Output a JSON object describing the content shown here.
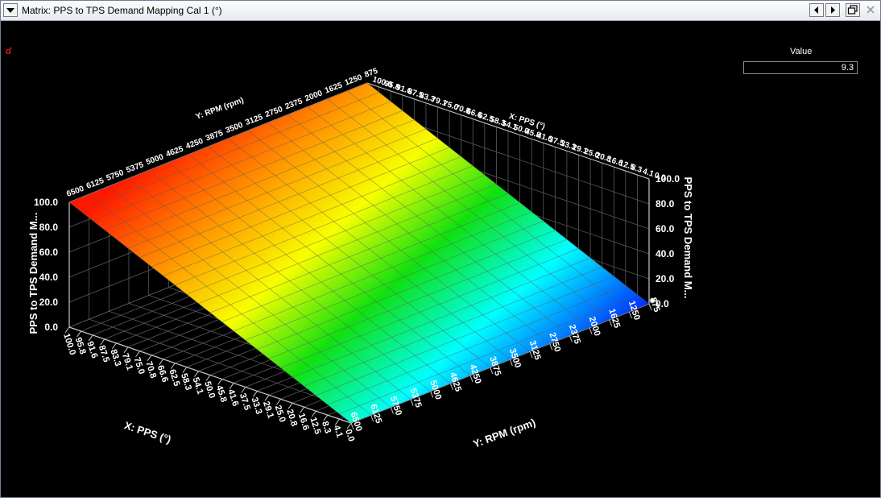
{
  "window": {
    "title": "Matrix: PPS to TPS Demand Mapping Cal 1 (°)",
    "buttons": [
      "menu-dropdown",
      "prev",
      "next",
      "restore",
      "close"
    ]
  },
  "readout": {
    "label": "Value",
    "value": "9.3"
  },
  "corner_mark": "ɗ",
  "chart_data": {
    "type": "surface3d",
    "x_axis": {
      "label": "X: PPS (°)",
      "ticks": [
        "100.0",
        "95.8",
        "91.6",
        "87.5",
        "83.3",
        "79.1",
        "75.0",
        "70.8",
        "66.6",
        "62.5",
        "58.3",
        "54.1",
        "50.0",
        "45.8",
        "41.6",
        "37.5",
        "33.3",
        "29.1",
        "25.0",
        "20.8",
        "16.6",
        "12.5",
        "8.3",
        "4.1",
        "0.0"
      ]
    },
    "y_axis": {
      "label": "Y: RPM (rpm)",
      "ticks": [
        "6500",
        "6125",
        "5750",
        "5375",
        "5000",
        "4625",
        "4250",
        "3875",
        "3500",
        "3125",
        "2750",
        "2375",
        "2000",
        "1625",
        "1250",
        "875"
      ]
    },
    "z_axis": {
      "label": "PPS to TPS Demand M...",
      "ticks": [
        "0.0",
        "20.0",
        "40.0",
        "60.0",
        "80.0",
        "100.0"
      ],
      "range": [
        0,
        100
      ]
    },
    "surface": "z equals PPS (independent of RPM); 100 at PPS 100, 0 at PPS 0",
    "colormap": [
      "#ff0000",
      "#ffa500",
      "#ffff00",
      "#00e000",
      "#00ffff",
      "#0040ff"
    ],
    "cursor": {
      "pps": "0.0",
      "rpm": "875"
    }
  }
}
